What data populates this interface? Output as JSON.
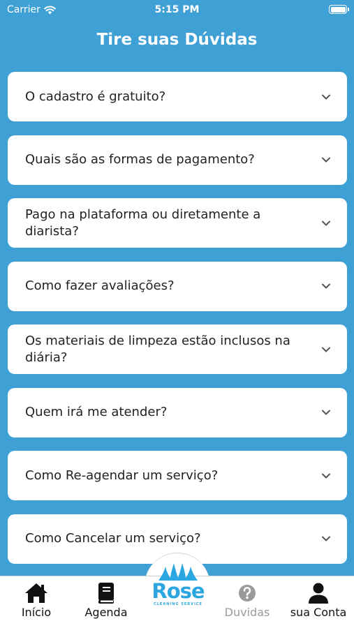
{
  "status_bar": {
    "carrier": "Carrier",
    "time": "5:15 PM"
  },
  "header": {
    "title": "Tire suas Dúvidas"
  },
  "faq": [
    {
      "question": "O cadastro é gratuito?"
    },
    {
      "question": "Quais são as formas de pagamento?"
    },
    {
      "question": "Pago na plataforma ou diretamente a diarista?"
    },
    {
      "question": "Como fazer avaliações?"
    },
    {
      "question": "Os materiais de limpeza estão inclusos na diária?"
    },
    {
      "question": "Quem irá me atender?"
    },
    {
      "question": "Como Re-agendar um serviço?"
    },
    {
      "question": "Como Cancelar um serviço?"
    }
  ],
  "tab_bar": {
    "items": [
      {
        "label": "Início",
        "icon": "home-icon"
      },
      {
        "label": "Agenda",
        "icon": "book-icon"
      },
      {
        "label": "Duvidas",
        "icon": "question-circle-icon"
      },
      {
        "label": "sua Conta",
        "icon": "user-icon"
      }
    ],
    "logo": {
      "brand": "Rose",
      "tagline": "CLEANING SERVICE"
    }
  },
  "colors": {
    "background": "#3fa0d6",
    "card": "#ffffff",
    "brand": "#2ba6e0",
    "inactive_tab": "#9a9a9a"
  }
}
